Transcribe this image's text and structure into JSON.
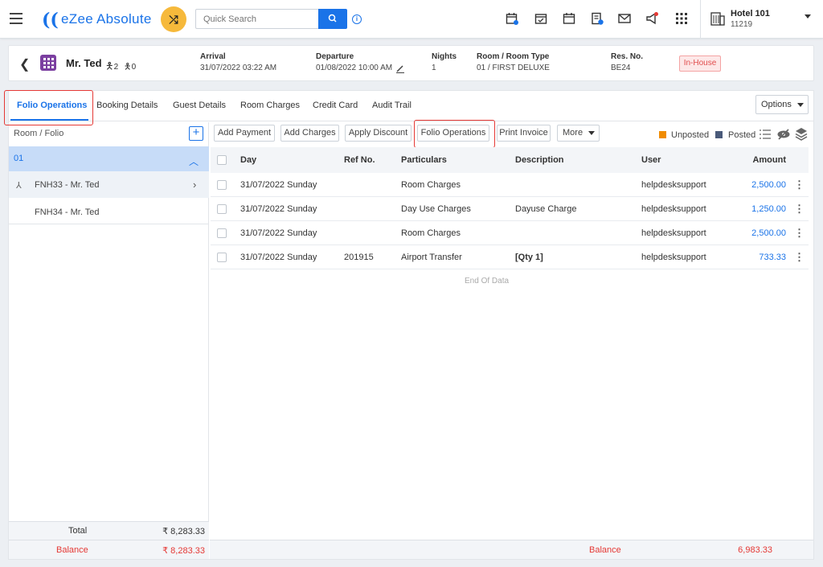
{
  "header": {
    "app_name": "eZee Absolute",
    "search_placeholder": "Quick Search",
    "hotel_name": "Hotel 101",
    "hotel_code": "11219"
  },
  "reservation": {
    "guest_name": "Mr. Ted",
    "adults": "2",
    "children": "0",
    "arrival_label": "Arrival",
    "arrival_value": "31/07/2022 03:22 AM",
    "departure_label": "Departure",
    "departure_value": "01/08/2022 10:00 AM",
    "nights_label": "Nights",
    "nights_value": "1",
    "room_label": "Room / Room Type",
    "room_value": "01 / FIRST DELUXE",
    "resno_label": "Res. No.",
    "resno_value": "BE24",
    "status": "In-House"
  },
  "tabs": [
    "Folio Operations",
    "Booking Details",
    "Guest Details",
    "Room Charges",
    "Credit Card",
    "Audit Trail"
  ],
  "options_label": "Options",
  "left": {
    "title": "Room / Folio",
    "room": "01",
    "folios": [
      "FNH33 - Mr. Ted",
      "FNH34 - Mr. Ted"
    ],
    "total_label": "Total",
    "total_value": "₹ 8,283.33",
    "balance_label": "Balance",
    "balance_value": "₹ 8,283.33"
  },
  "actions": [
    "Add Payment",
    "Add Charges",
    "Apply Discount",
    "Folio Operations",
    "Print Invoice",
    "More"
  ],
  "legend": {
    "unposted": "Unposted",
    "posted": "Posted",
    "unposted_color": "#f08c00",
    "posted_color": "#4a5a7a"
  },
  "table": {
    "columns": [
      "Day",
      "Ref No.",
      "Particulars",
      "Description",
      "User",
      "Amount"
    ],
    "rows": [
      {
        "day": "31/07/2022 Sunday",
        "ref": "",
        "particulars": "Room Charges",
        "description": "",
        "user": "helpdesksupport",
        "amount": "2,500.00"
      },
      {
        "day": "31/07/2022 Sunday",
        "ref": "",
        "particulars": "Day Use Charges",
        "description": "Dayuse Charge",
        "user": "helpdesksupport",
        "amount": "1,250.00"
      },
      {
        "day": "31/07/2022 Sunday",
        "ref": "",
        "particulars": "Room Charges",
        "description": "",
        "user": "helpdesksupport",
        "amount": "2,500.00"
      },
      {
        "day": "31/07/2022 Sunday",
        "ref": "201915",
        "particulars": "Airport Transfer",
        "description": "[Qty 1]",
        "user": "helpdesksupport",
        "amount": "733.33"
      }
    ],
    "end_text": "End Of Data",
    "balance_label": "Balance",
    "balance_value": "6,983.33"
  }
}
